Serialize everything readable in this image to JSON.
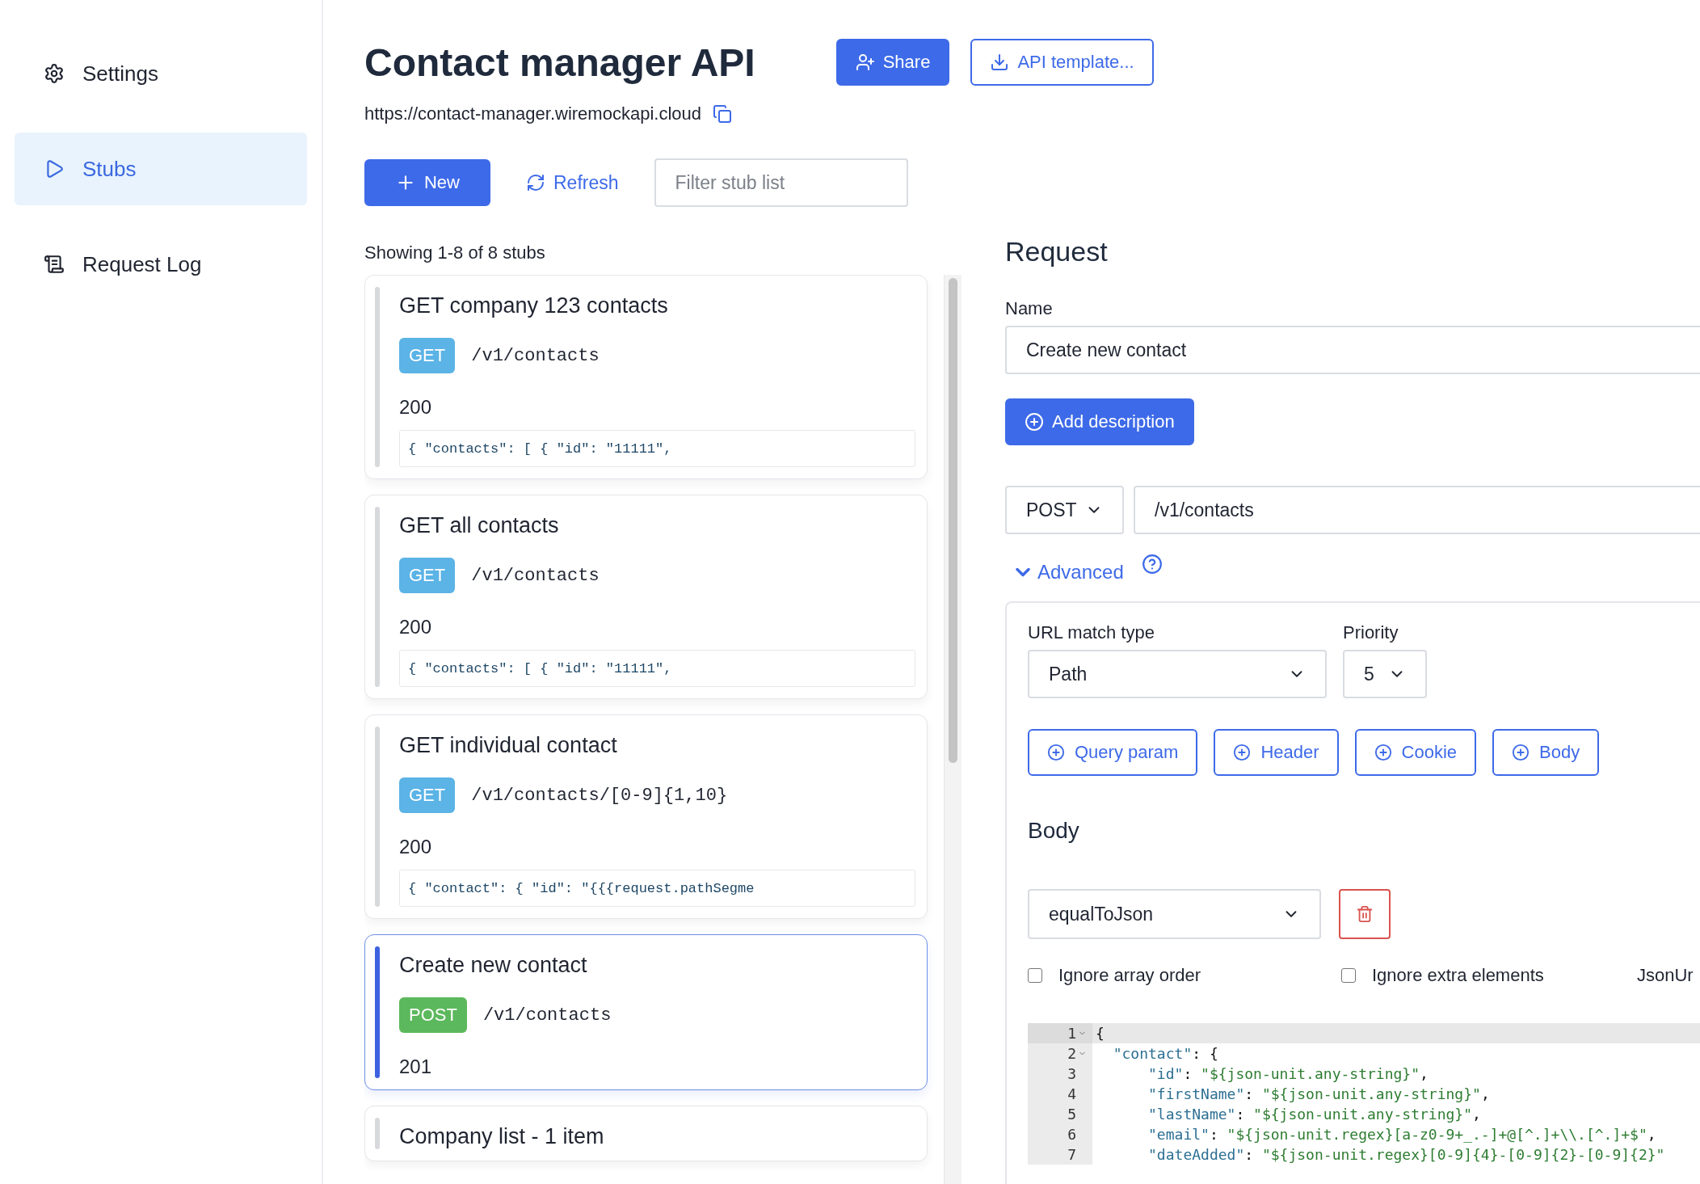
{
  "sidebar": {
    "items": [
      {
        "label": "Settings",
        "kind": "settings",
        "selected": false
      },
      {
        "label": "Stubs",
        "kind": "play",
        "selected": true
      },
      {
        "label": "Request Log",
        "kind": "log",
        "selected": false
      }
    ]
  },
  "header": {
    "title": "Contact manager API",
    "share_button": "Share",
    "template_button": "API template...",
    "url": "https://contact-manager.wiremockapi.cloud"
  },
  "toolbar": {
    "new_button": "New",
    "refresh_button": "Refresh",
    "filter_placeholder": "Filter stub list"
  },
  "stub_list": {
    "summary": "Showing 1-8 of 8 stubs",
    "stubs": [
      {
        "name": "GET company 123 contacts",
        "method": "GET",
        "color": "#5bb3e6",
        "path": "/v1/contacts",
        "status": "200",
        "body_preview": "{ \"contacts\": [ { \"id\": \"11111\",",
        "selected": false
      },
      {
        "name": "GET all contacts",
        "method": "GET",
        "color": "#5bb3e6",
        "path": "/v1/contacts",
        "status": "200",
        "body_preview": "{ \"contacts\": [ { \"id\": \"11111\",",
        "selected": false
      },
      {
        "name": "GET individual contact",
        "method": "GET",
        "color": "#5bb3e6",
        "path": "/v1/contacts/[0-9]{1,10}",
        "status": "200",
        "body_preview": "{ \"contact\": { \"id\": \"{{{request.pathSegme",
        "selected": false
      },
      {
        "name": "Create new contact",
        "method": "POST",
        "color": "#5cb85c",
        "path": "/v1/contacts",
        "status": "201",
        "selected": true
      },
      {
        "name": "Company list - 1 item",
        "selected": false
      }
    ]
  },
  "request": {
    "heading": "Request",
    "name_label": "Name",
    "name_value": "Create new contact",
    "add_description_button": "Add description",
    "method": "POST",
    "path": "/v1/contacts",
    "advanced_toggle": "Advanced",
    "advanced_expanded": true,
    "url_match_label": "URL match type",
    "url_match_value": "Path",
    "priority_label": "Priority",
    "priority_value": "5",
    "matcher_buttons": [
      "Query param",
      "Header",
      "Cookie",
      "Body"
    ],
    "body_heading": "Body",
    "body_matcher": "equalToJson",
    "options": [
      {
        "label": "Ignore array order",
        "checked": false
      },
      {
        "label": "Ignore extra elements",
        "checked": false
      }
    ],
    "json_unit_label": "JsonUr",
    "code_lines": [
      {
        "number": "1",
        "text": "{",
        "foldable": true,
        "active": true
      },
      {
        "number": "2",
        "text": "  \"contact\": {",
        "foldable": true,
        "active": false
      },
      {
        "number": "3",
        "text": "      \"id\": \"${json-unit.any-string}\",",
        "foldable": false,
        "active": false
      },
      {
        "number": "4",
        "text": "      \"firstName\": \"${json-unit.any-string}\",",
        "foldable": false,
        "active": false
      },
      {
        "number": "5",
        "text": "      \"lastName\": \"${json-unit.any-string}\",",
        "foldable": false,
        "active": false
      },
      {
        "number": "6",
        "text": "      \"email\": \"${json-unit.regex}[a-z0-9+_.-]+@[^.]+\\\\.[^.]+$\",",
        "foldable": false,
        "active": false
      },
      {
        "number": "7",
        "text": "      \"dateAdded\": \"${json-unit.regex}[0-9]{4}-[0-9]{2}-[0-9]{2}\"",
        "foldable": false,
        "active": false
      }
    ]
  }
}
